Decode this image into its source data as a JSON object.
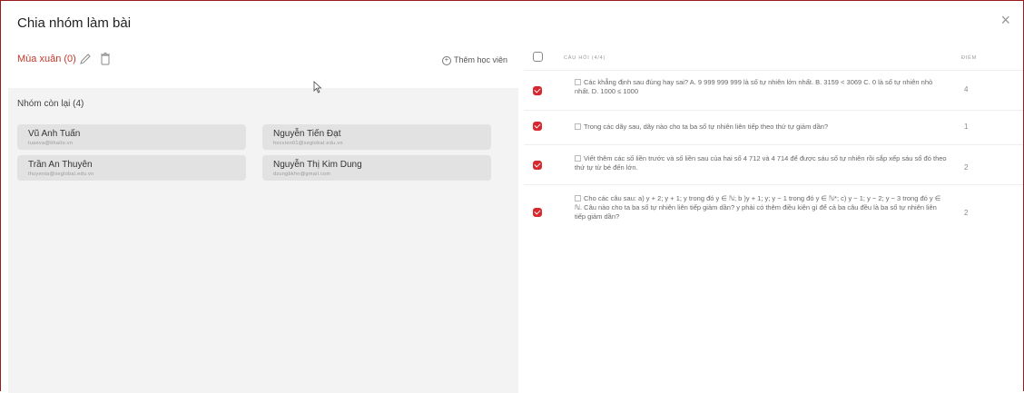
{
  "modal": {
    "title": "Chia nhóm làm bài",
    "close_label": "×"
  },
  "group": {
    "name": "Mùa xuân (0)",
    "add_student_label": "Thêm học viên"
  },
  "remaining": {
    "label": "Nhóm còn lại (4)",
    "students": [
      {
        "name": "Vũ Anh Tuấn",
        "email": "tuanva@tihaito.vn"
      },
      {
        "name": "Nguyễn Tiến Đạt",
        "email": "hocvien01@seglobal.edu.vn"
      },
      {
        "name": "Trần An Thuyên",
        "email": "thuyenta@seglobal.edu.vn"
      },
      {
        "name": "Nguyễn Thị Kim Dung",
        "email": "dzungbkhn@gmail.com"
      }
    ]
  },
  "questions": {
    "header_question": "CÂU HỎI (4/4)",
    "header_points": "ĐIỂM",
    "rows": [
      {
        "text": "Các khẳng định sau đúng hay sai? A. 9 999 999 999 là số tự nhiên lớn nhất. B. 3159 < 3069 C. 0 là số tự nhiên nhỏ nhất. D. 1000 ≤ 1000",
        "points": "4",
        "checked": true
      },
      {
        "text": "Trong các dãy sau, dãy nào cho ta ba số tự nhiên liên tiếp theo thứ tự giảm dần?",
        "points": "1",
        "checked": true
      },
      {
        "text": "Viết thêm các số liền trước và số liền sau của hai số 4 712 và 4 714 để được sáu số tự nhiên rồi sắp xếp sáu số đó theo thứ tự từ bé đến lớn.",
        "points": "2",
        "checked": true
      },
      {
        "text": "Cho các câu sau: a) y + 2; y + 1; y trong đó y ∈ ℕ; b )y + 1; y; y − 1 trong đó y ∈ ℕ*; c) y − 1; y − 2; y − 3 trong đó y ∈ ℕ. Câu nào cho ta ba số tự nhiên liên tiếp giảm dần? y phải có thêm điều kiện gì để cả ba câu đều là ba số tự nhiên liên tiếp giảm dần?",
        "points": "2",
        "checked": true
      }
    ]
  },
  "colors": {
    "accent": "#d8282f",
    "group_name": "#c0392b",
    "panel_bg": "#f3f3f3",
    "card_bg": "#e2e2e2"
  },
  "icons": {
    "edit": "pencil-icon",
    "delete": "trash-icon",
    "close": "close-icon",
    "add": "plus-circle-icon",
    "question": "document-icon"
  }
}
